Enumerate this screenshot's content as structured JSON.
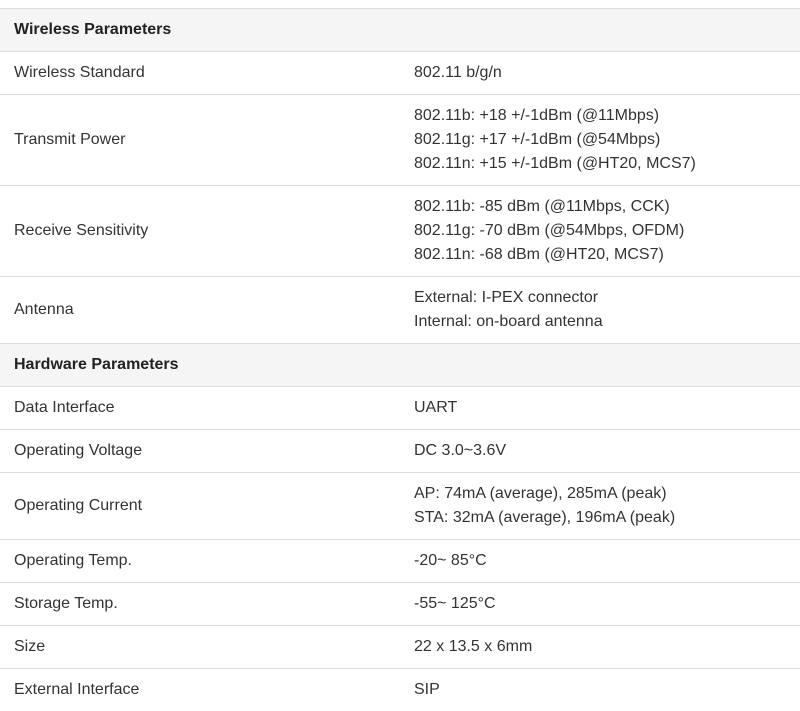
{
  "sections": [
    {
      "title": "Wireless Parameters",
      "rows": [
        {
          "label": "Wireless Standard",
          "values": [
            "802.11 b/g/n"
          ]
        },
        {
          "label": "Transmit Power",
          "values": [
            "802.11b: +18 +/-1dBm (@11Mbps)",
            "802.11g: +17 +/-1dBm (@54Mbps)",
            "802.11n: +15 +/-1dBm (@HT20, MCS7)"
          ]
        },
        {
          "label": "Receive Sensitivity",
          "values": [
            "802.11b: -85 dBm (@11Mbps, CCK)",
            "802.11g: -70 dBm (@54Mbps, OFDM)",
            "802.11n: -68 dBm (@HT20, MCS7)"
          ]
        },
        {
          "label": "Antenna",
          "values": [
            "External: I-PEX connector",
            "Internal: on-board antenna"
          ]
        }
      ]
    },
    {
      "title": "Hardware Parameters",
      "rows": [
        {
          "label": "Data Interface",
          "values": [
            "UART"
          ]
        },
        {
          "label": "Operating Voltage",
          "values": [
            "DC 3.0~3.6V"
          ]
        },
        {
          "label": "Operating Current",
          "values": [
            "AP: 74mA (average), 285mA (peak)",
            "STA: 32mA (average), 196mA (peak)"
          ]
        },
        {
          "label": "Operating Temp.",
          "values": [
            "-20~ 85°C"
          ]
        },
        {
          "label": "Storage Temp.",
          "values": [
            "-55~ 125°C"
          ]
        },
        {
          "label": "Size",
          "values": [
            "22 x 13.5 x 6mm"
          ]
        },
        {
          "label": "External Interface",
          "values": [
            "SIP"
          ]
        }
      ]
    }
  ]
}
